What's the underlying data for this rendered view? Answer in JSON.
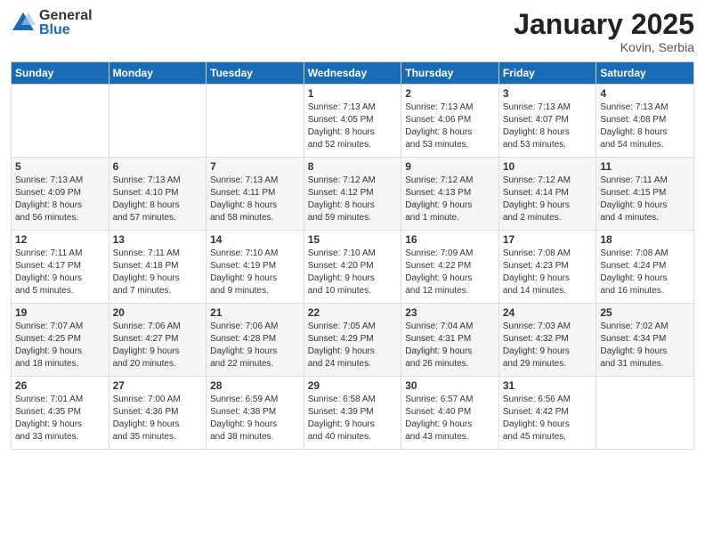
{
  "logo": {
    "general": "General",
    "blue": "Blue"
  },
  "title": "January 2025",
  "location": "Kovin, Serbia",
  "header": {
    "days": [
      "Sunday",
      "Monday",
      "Tuesday",
      "Wednesday",
      "Thursday",
      "Friday",
      "Saturday"
    ]
  },
  "weeks": [
    {
      "cells": [
        {
          "day": "",
          "info": ""
        },
        {
          "day": "",
          "info": ""
        },
        {
          "day": "",
          "info": ""
        },
        {
          "day": "1",
          "info": "Sunrise: 7:13 AM\nSunset: 4:05 PM\nDaylight: 8 hours\nand 52 minutes."
        },
        {
          "day": "2",
          "info": "Sunrise: 7:13 AM\nSunset: 4:06 PM\nDaylight: 8 hours\nand 53 minutes."
        },
        {
          "day": "3",
          "info": "Sunrise: 7:13 AM\nSunset: 4:07 PM\nDaylight: 8 hours\nand 53 minutes."
        },
        {
          "day": "4",
          "info": "Sunrise: 7:13 AM\nSunset: 4:08 PM\nDaylight: 8 hours\nand 54 minutes."
        }
      ]
    },
    {
      "cells": [
        {
          "day": "5",
          "info": "Sunrise: 7:13 AM\nSunset: 4:09 PM\nDaylight: 8 hours\nand 56 minutes."
        },
        {
          "day": "6",
          "info": "Sunrise: 7:13 AM\nSunset: 4:10 PM\nDaylight: 8 hours\nand 57 minutes."
        },
        {
          "day": "7",
          "info": "Sunrise: 7:13 AM\nSunset: 4:11 PM\nDaylight: 8 hours\nand 58 minutes."
        },
        {
          "day": "8",
          "info": "Sunrise: 7:12 AM\nSunset: 4:12 PM\nDaylight: 8 hours\nand 59 minutes."
        },
        {
          "day": "9",
          "info": "Sunrise: 7:12 AM\nSunset: 4:13 PM\nDaylight: 9 hours\nand 1 minute."
        },
        {
          "day": "10",
          "info": "Sunrise: 7:12 AM\nSunset: 4:14 PM\nDaylight: 9 hours\nand 2 minutes."
        },
        {
          "day": "11",
          "info": "Sunrise: 7:11 AM\nSunset: 4:15 PM\nDaylight: 9 hours\nand 4 minutes."
        }
      ]
    },
    {
      "cells": [
        {
          "day": "12",
          "info": "Sunrise: 7:11 AM\nSunset: 4:17 PM\nDaylight: 9 hours\nand 5 minutes."
        },
        {
          "day": "13",
          "info": "Sunrise: 7:11 AM\nSunset: 4:18 PM\nDaylight: 9 hours\nand 7 minutes."
        },
        {
          "day": "14",
          "info": "Sunrise: 7:10 AM\nSunset: 4:19 PM\nDaylight: 9 hours\nand 9 minutes."
        },
        {
          "day": "15",
          "info": "Sunrise: 7:10 AM\nSunset: 4:20 PM\nDaylight: 9 hours\nand 10 minutes."
        },
        {
          "day": "16",
          "info": "Sunrise: 7:09 AM\nSunset: 4:22 PM\nDaylight: 9 hours\nand 12 minutes."
        },
        {
          "day": "17",
          "info": "Sunrise: 7:08 AM\nSunset: 4:23 PM\nDaylight: 9 hours\nand 14 minutes."
        },
        {
          "day": "18",
          "info": "Sunrise: 7:08 AM\nSunset: 4:24 PM\nDaylight: 9 hours\nand 16 minutes."
        }
      ]
    },
    {
      "cells": [
        {
          "day": "19",
          "info": "Sunrise: 7:07 AM\nSunset: 4:25 PM\nDaylight: 9 hours\nand 18 minutes."
        },
        {
          "day": "20",
          "info": "Sunrise: 7:06 AM\nSunset: 4:27 PM\nDaylight: 9 hours\nand 20 minutes."
        },
        {
          "day": "21",
          "info": "Sunrise: 7:06 AM\nSunset: 4:28 PM\nDaylight: 9 hours\nand 22 minutes."
        },
        {
          "day": "22",
          "info": "Sunrise: 7:05 AM\nSunset: 4:29 PM\nDaylight: 9 hours\nand 24 minutes."
        },
        {
          "day": "23",
          "info": "Sunrise: 7:04 AM\nSunset: 4:31 PM\nDaylight: 9 hours\nand 26 minutes."
        },
        {
          "day": "24",
          "info": "Sunrise: 7:03 AM\nSunset: 4:32 PM\nDaylight: 9 hours\nand 29 minutes."
        },
        {
          "day": "25",
          "info": "Sunrise: 7:02 AM\nSunset: 4:34 PM\nDaylight: 9 hours\nand 31 minutes."
        }
      ]
    },
    {
      "cells": [
        {
          "day": "26",
          "info": "Sunrise: 7:01 AM\nSunset: 4:35 PM\nDaylight: 9 hours\nand 33 minutes."
        },
        {
          "day": "27",
          "info": "Sunrise: 7:00 AM\nSunset: 4:36 PM\nDaylight: 9 hours\nand 35 minutes."
        },
        {
          "day": "28",
          "info": "Sunrise: 6:59 AM\nSunset: 4:38 PM\nDaylight: 9 hours\nand 38 minutes."
        },
        {
          "day": "29",
          "info": "Sunrise: 6:58 AM\nSunset: 4:39 PM\nDaylight: 9 hours\nand 40 minutes."
        },
        {
          "day": "30",
          "info": "Sunrise: 6:57 AM\nSunset: 4:40 PM\nDaylight: 9 hours\nand 43 minutes."
        },
        {
          "day": "31",
          "info": "Sunrise: 6:56 AM\nSunset: 4:42 PM\nDaylight: 9 hours\nand 45 minutes."
        },
        {
          "day": "",
          "info": ""
        }
      ]
    }
  ]
}
